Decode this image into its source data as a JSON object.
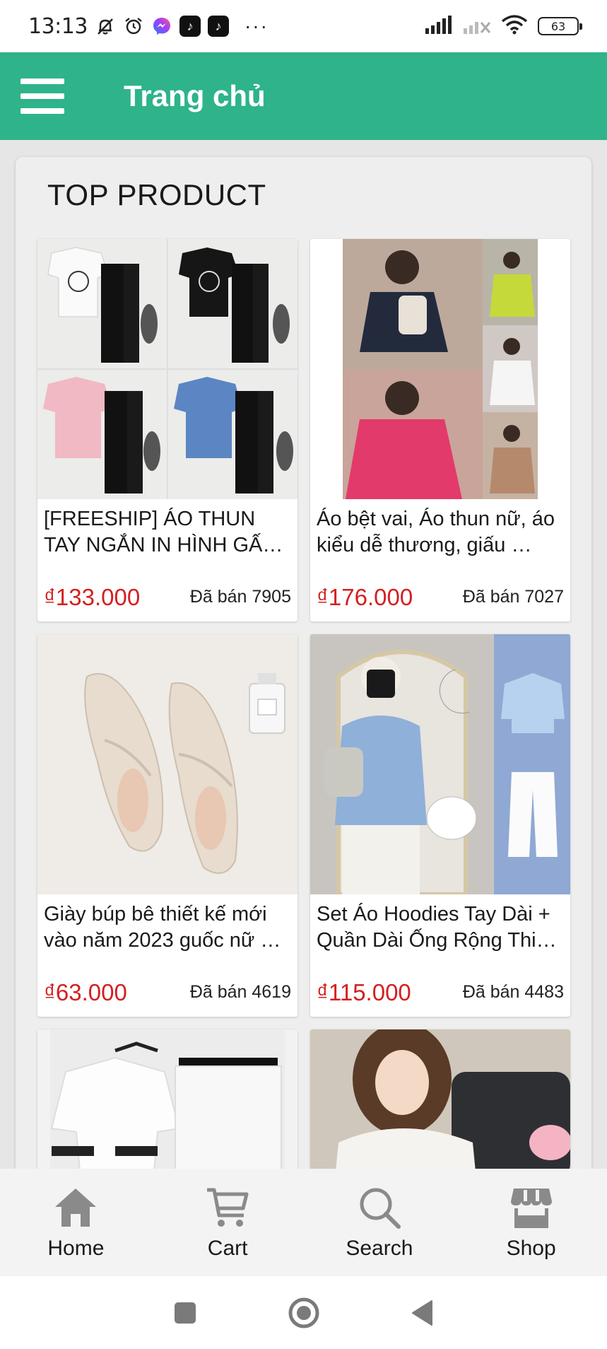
{
  "status_bar": {
    "time": "13:13",
    "battery": "63",
    "more": "···",
    "tiktok_glyph": "♪"
  },
  "app_bar": {
    "title": "Trang chủ"
  },
  "section": {
    "title": "TOP PRODUCT"
  },
  "products": [
    {
      "name": "[FREESHIP] ÁO THUN TAY NGẮN IN HÌNH GẤ…",
      "price": "₫133.000",
      "sold": "Đã bán 7905",
      "image": "four-tshirt-pant-sets-photo"
    },
    {
      "name": "Áo bệt vai, Áo thun nữ, áo kiểu dễ thương, giấu …",
      "price": "₫176.000",
      "sold": "Đã bán 7027",
      "image": "off-shoulder-tops-collage-photo"
    },
    {
      "name": "Giày búp bê thiết kế mới vào năm 2023 guốc nữ …",
      "price": "₫63.000",
      "sold": "Đã bán 4619",
      "image": "cream-flat-shoes-photo"
    },
    {
      "name": "Set Áo Hoodies Tay Dài + Quần Dài Ống Rộng Thi…",
      "price": "₫115.000",
      "sold": "Đã bán 4483",
      "image": "hoodie-set-mirror-selfie-photo"
    },
    {
      "image": "white-tshirt-shorts-set-photo"
    },
    {
      "image": "woman-white-sweater-photo"
    }
  ],
  "bottom_nav": {
    "items": [
      {
        "label": "Home",
        "icon": "home-icon"
      },
      {
        "label": "Cart",
        "icon": "cart-icon"
      },
      {
        "label": "Search",
        "icon": "search-icon"
      },
      {
        "label": "Shop",
        "icon": "shop-icon"
      }
    ]
  },
  "colors": {
    "app_bar": "#2eb38b",
    "price": "#d32020",
    "nav_icon": "#8a8a8a"
  }
}
